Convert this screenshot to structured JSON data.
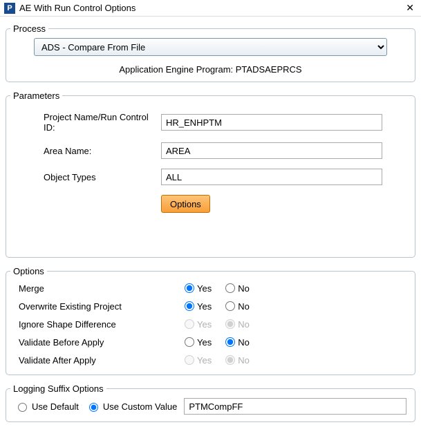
{
  "window": {
    "app_icon_letter": "P",
    "title": "AE With Run Control Options",
    "close_glyph": "✕"
  },
  "process": {
    "legend": "Process",
    "selected": "ADS - Compare From File",
    "program_line": "Application Engine Program: PTADSAEPRCS"
  },
  "parameters": {
    "legend": "Parameters",
    "rows": [
      {
        "label": "Project Name/Run Control ID:",
        "value": "HR_ENHPTM"
      },
      {
        "label": "Area Name:",
        "value": "AREA"
      },
      {
        "label": "Object Types",
        "value": "ALL"
      }
    ],
    "options_button": "Options"
  },
  "options": {
    "legend": "Options",
    "yes": "Yes",
    "no": "No",
    "rows": [
      {
        "label": "Merge",
        "value": "yes",
        "disabled": false
      },
      {
        "label": "Overwrite Existing Project",
        "value": "yes",
        "disabled": false
      },
      {
        "label": "Ignore Shape Difference",
        "value": "no",
        "disabled": true
      },
      {
        "label": "Validate Before Apply",
        "value": "no",
        "disabled": false
      },
      {
        "label": "Validate After Apply",
        "value": "no",
        "disabled": true
      }
    ]
  },
  "logging": {
    "legend": "Logging Suffix Options",
    "use_default": "Use Default",
    "use_custom": "Use Custom Value",
    "selected": "custom",
    "value": "PTMCompFF"
  }
}
